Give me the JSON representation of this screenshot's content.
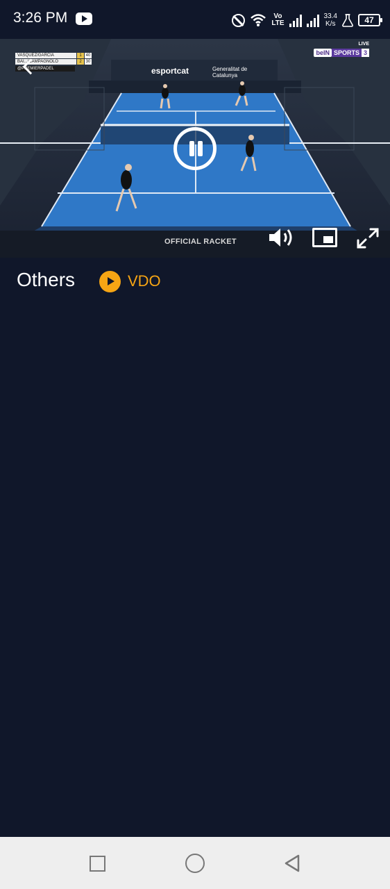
{
  "status_bar": {
    "time": "3:26 PM",
    "volte_top": "Vo",
    "volte_bottom": "LTE",
    "net_speed_value": "33.4",
    "net_speed_unit": "K/s",
    "battery": "47",
    "icons": [
      "youtube-icon",
      "dnd-icon",
      "wifi-icon",
      "signal-icon",
      "signal-icon",
      "flask-icon",
      "battery-icon"
    ]
  },
  "video": {
    "scoreboard": {
      "team1": "VASQUEZ/GARCIA",
      "team1_set": "1",
      "team1_points": "40",
      "team2": "BAI.../CAMPAGNOLO",
      "team2_set": "2",
      "team2_points": "30",
      "handle": "@PREMIERPADEL"
    },
    "channel": {
      "live": "LIVE",
      "brand": "beIN",
      "name": "SPORTS",
      "number": "3"
    },
    "sponsor_top": "esportcat",
    "sponsor_gov": "Generalitat de Catalunya",
    "bottom_banner": "OFFICIAL RACKET",
    "controls": [
      "back-icon",
      "pause-icon",
      "volume-icon",
      "pip-icon",
      "fullscreen-icon"
    ]
  },
  "section": {
    "title": "Others",
    "vdo_label": "VDO",
    "accent_color": "#f6a514"
  },
  "background_color": "#10172a",
  "nav_bar": {
    "buttons": [
      "recents-button",
      "home-button",
      "back-button"
    ]
  }
}
